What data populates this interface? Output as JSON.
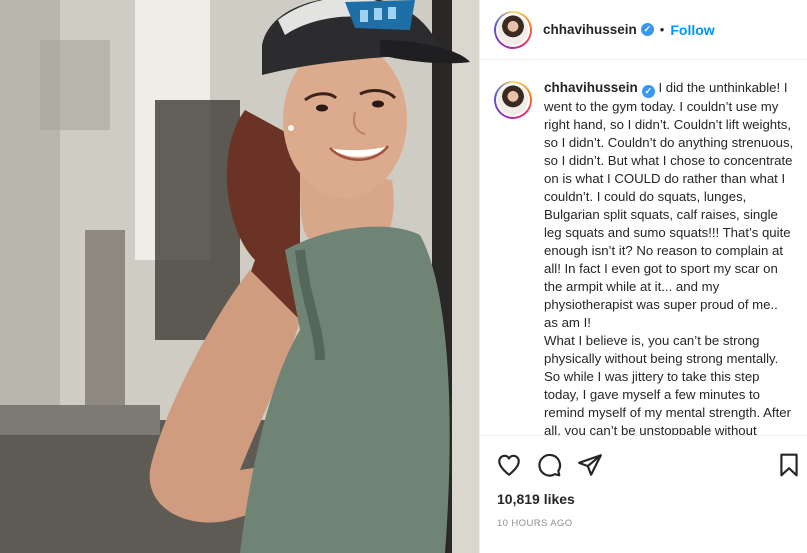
{
  "post": {
    "username": "chhavihussein",
    "follow_label": "Follow",
    "separator": "•",
    "verified_mark": "✓",
    "caption": "I did the unthinkable! I went to the gym today. I couldn’t use my right hand, so I didn’t. Couldn’t lift weights, so I didn’t. Couldn’t do anything strenuous, so I didn’t. But what I chose to concentrate on is what I COULD do rather than what I couldn’t. I could do squats, lunges, Bulgarian split squats, calf raises, single leg squats and sumo squats!!! That’s quite enough isn’t it? No reason to complain at all! In fact I even got to sport my scar on the armpit while at it... and my physiotherapist was super proud of me.. as am I!\nWhat I believe is, you can’t be strong physically without being strong mentally. So while I was jittery to take this step today, I gave myself a few minutes to remind myself of my mental strength. After all, you can’t be unstoppable without",
    "likes": "10,819 likes",
    "timestamp": "10 HOURS AGO"
  },
  "icons": {
    "like": "heart-icon",
    "comment": "comment-icon",
    "share": "paper-plane-icon",
    "save": "bookmark-icon",
    "verified": "verified-badge-icon"
  },
  "colors": {
    "link": "#0095f6",
    "verified": "#3897f0",
    "muted": "#8e8e8e",
    "text": "#262626"
  }
}
